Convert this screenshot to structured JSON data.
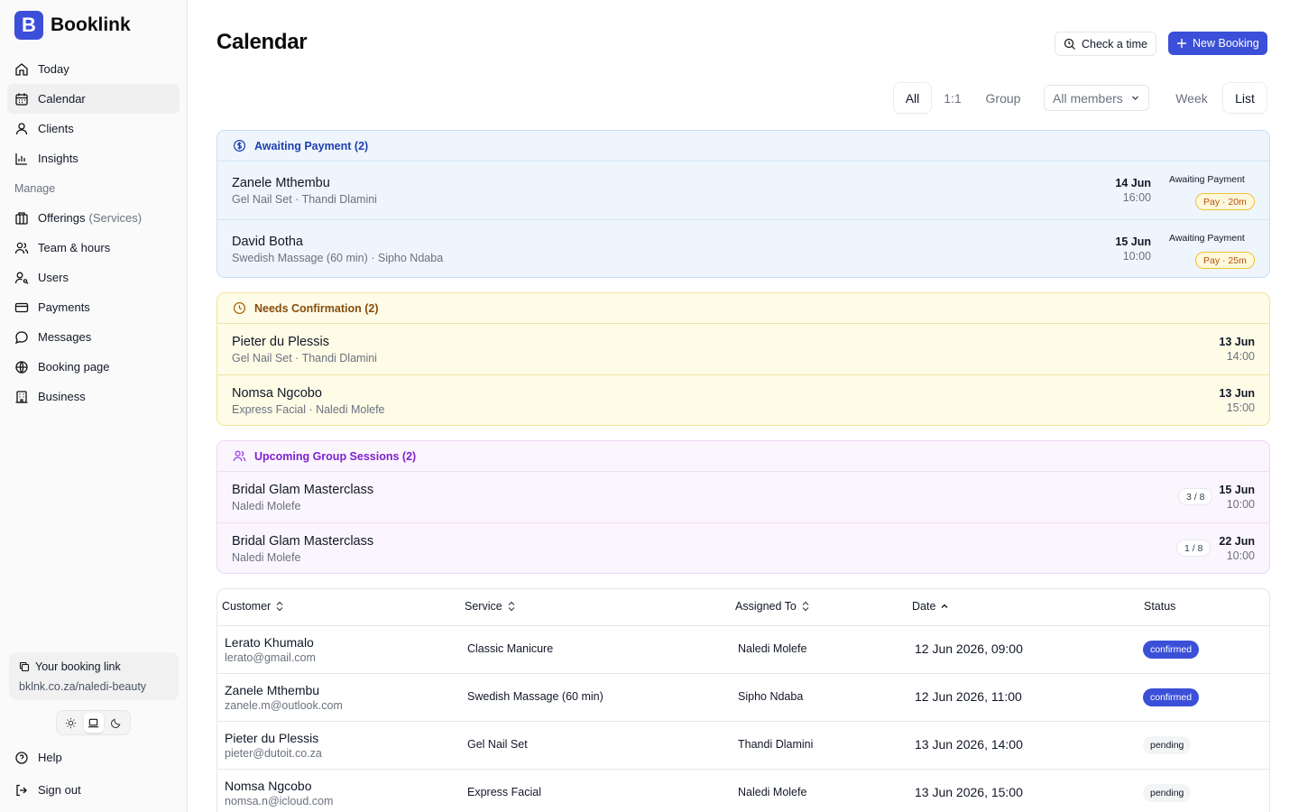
{
  "app": {
    "name": "Booklink",
    "logo_letter": "B",
    "accent": "#3b4fd8"
  },
  "sidebar": {
    "items": [
      {
        "label": "Today",
        "icon": "home-icon"
      },
      {
        "label": "Calendar",
        "icon": "calendar-icon",
        "active": true
      },
      {
        "label": "Clients",
        "icon": "user-icon"
      },
      {
        "label": "Insights",
        "icon": "chart-icon"
      }
    ],
    "manage_title": "Manage",
    "manage_items": [
      {
        "label": "Offerings",
        "suffix": "(Services)",
        "icon": "building-icon"
      },
      {
        "label": "Team & hours",
        "icon": "users-icon"
      },
      {
        "label": "Users",
        "icon": "user-key-icon"
      },
      {
        "label": "Payments",
        "icon": "credit-card-icon"
      },
      {
        "label": "Messages",
        "icon": "message-icon"
      },
      {
        "label": "Booking page",
        "icon": "globe-icon"
      },
      {
        "label": "Business",
        "icon": "office-icon"
      }
    ],
    "booking_link": {
      "title": "Your booking link",
      "url": "bklnk.co.za/naledi-beauty"
    },
    "theme": {
      "options": [
        "sun-icon",
        "laptop-icon",
        "moon-icon"
      ],
      "selected": "laptop-icon"
    },
    "help": "Help",
    "signout": "Sign out"
  },
  "header": {
    "title": "Calendar",
    "check_time": "Check a time",
    "new_booking": "New Booking"
  },
  "filters": {
    "type_tabs": [
      "All",
      "1:1",
      "Group"
    ],
    "type_selected": "All",
    "member_select": "All members",
    "view_tabs": [
      "Week",
      "List"
    ],
    "view_selected": "List"
  },
  "awaiting": {
    "title": "Awaiting Payment (2)",
    "rows": [
      {
        "name": "Zanele Mthembu",
        "sub": "Gel Nail Set · Thandi Dlamini",
        "date": "14 Jun",
        "time": "16:00",
        "status": "Awaiting Payment",
        "badge": "Pay · 20m"
      },
      {
        "name": "David Botha",
        "sub": "Swedish Massage (60 min) · Sipho Ndaba",
        "date": "15 Jun",
        "time": "10:00",
        "status": "Awaiting Payment",
        "badge": "Pay · 25m"
      }
    ]
  },
  "confirm": {
    "title": "Needs Confirmation (2)",
    "rows": [
      {
        "name": "Pieter du Plessis",
        "sub": "Gel Nail Set · Thandi Dlamini",
        "date": "13 Jun",
        "time": "14:00"
      },
      {
        "name": "Nomsa Ngcobo",
        "sub": "Express Facial · Naledi Molefe",
        "date": "13 Jun",
        "time": "15:00"
      }
    ]
  },
  "group": {
    "title": "Upcoming Group Sessions (2)",
    "rows": [
      {
        "name": "Bridal Glam Masterclass",
        "sub": "Naledi Molefe",
        "count": "3 / 8",
        "date": "15 Jun",
        "time": "10:00"
      },
      {
        "name": "Bridal Glam Masterclass",
        "sub": "Naledi Molefe",
        "count": "1 / 8",
        "date": "22 Jun",
        "time": "10:00"
      }
    ]
  },
  "table": {
    "headers": [
      "Customer",
      "Service",
      "Assigned To",
      "Date",
      "Status"
    ],
    "rows": [
      {
        "name": "Lerato Khumalo",
        "email": "lerato@gmail.com",
        "service": "Classic Manicure",
        "assigned": "Naledi Molefe",
        "date": "12 Jun 2026, 09:00",
        "status": "confirmed"
      },
      {
        "name": "Zanele Mthembu",
        "email": "zanele.m@outlook.com",
        "service": "Swedish Massage (60 min)",
        "assigned": "Sipho Ndaba",
        "date": "12 Jun 2026, 11:00",
        "status": "confirmed"
      },
      {
        "name": "Pieter du Plessis",
        "email": "pieter@dutoit.co.za",
        "service": "Gel Nail Set",
        "assigned": "Thandi Dlamini",
        "date": "13 Jun 2026, 14:00",
        "status": "pending"
      },
      {
        "name": "Nomsa Ngcobo",
        "email": "nomsa.n@icloud.com",
        "service": "Express Facial",
        "assigned": "Naledi Molefe",
        "date": "13 Jun 2026, 15:00",
        "status": "pending"
      }
    ]
  }
}
